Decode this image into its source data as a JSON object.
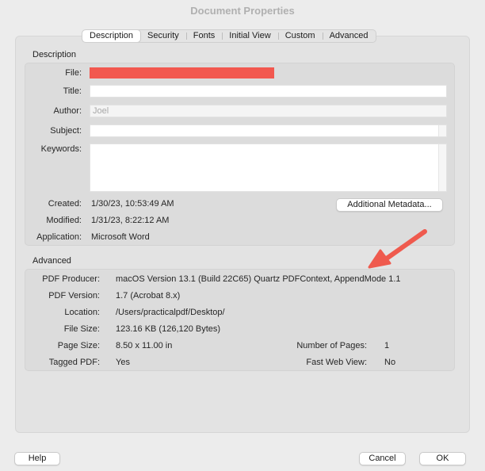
{
  "window": {
    "title": "Document Properties"
  },
  "tabs": [
    {
      "label": "Description",
      "active": true
    },
    {
      "label": "Security",
      "active": false
    },
    {
      "label": "Fonts",
      "active": false
    },
    {
      "label": "Initial View",
      "active": false
    },
    {
      "label": "Custom",
      "active": false
    },
    {
      "label": "Advanced",
      "active": false
    }
  ],
  "description": {
    "section_title": "Description",
    "file_label": "File:",
    "file_value": "",
    "title_label": "Title:",
    "title_value": "",
    "author_label": "Author:",
    "author_value": "Joel",
    "subject_label": "Subject:",
    "subject_value": "",
    "keywords_label": "Keywords:",
    "keywords_value": "",
    "created_label": "Created:",
    "created_value": "1/30/23, 10:53:49 AM",
    "modified_label": "Modified:",
    "modified_value": "1/31/23, 8:22:12 AM",
    "application_label": "Application:",
    "application_value": "Microsoft Word",
    "additional_metadata_button": "Additional Metadata..."
  },
  "advanced": {
    "section_title": "Advanced",
    "producer_label": "PDF Producer:",
    "producer_value": "macOS Version 13.1 (Build 22C65) Quartz PDFContext, AppendMode 1.1",
    "version_label": "PDF Version:",
    "version_value": "1.7 (Acrobat 8.x)",
    "location_label": "Location:",
    "location_value": "/Users/practicalpdf/Desktop/",
    "filesize_label": "File Size:",
    "filesize_value": "123.16 KB (126,120 Bytes)",
    "pagesize_label": "Page Size:",
    "pagesize_value": "8.50 x 11.00 in",
    "numpages_label": "Number of Pages:",
    "numpages_value": "1",
    "tagged_label": "Tagged PDF:",
    "tagged_value": "Yes",
    "fastweb_label": "Fast Web View:",
    "fastweb_value": "No"
  },
  "footer": {
    "help_button": "Help",
    "cancel_button": "Cancel",
    "ok_button": "OK"
  },
  "colors": {
    "redaction": "#f2584f",
    "annotation_arrow": "#ef5a4e"
  }
}
